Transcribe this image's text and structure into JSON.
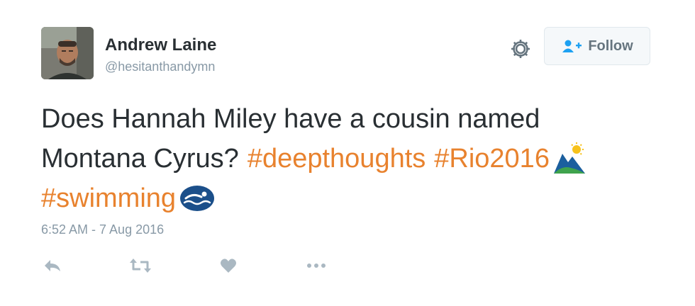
{
  "tweet": {
    "author": {
      "name": "Andrew Laine",
      "handle": "@hesitanthandymn"
    },
    "follow_label": "Follow",
    "text_line1": "Does Hannah Miley have a cousin named",
    "text_line2_plain": "Montana Cyrus?",
    "hashtags": [
      "#deepthoughts",
      "#Rio2016",
      "#swimming"
    ],
    "timestamp": "6:52 AM - 7 Aug 2016",
    "icons": [
      "gear-icon",
      "follow-user-plus-icon",
      "rio2016-emoji",
      "swimming-emoji",
      "reply-icon",
      "retweet-icon",
      "like-heart-icon",
      "more-dots-icon"
    ],
    "colors": {
      "hashtag": "#e8822e",
      "text": "#292f33",
      "secondary": "#8899a6",
      "follow_icon": "#1da1f2"
    }
  }
}
